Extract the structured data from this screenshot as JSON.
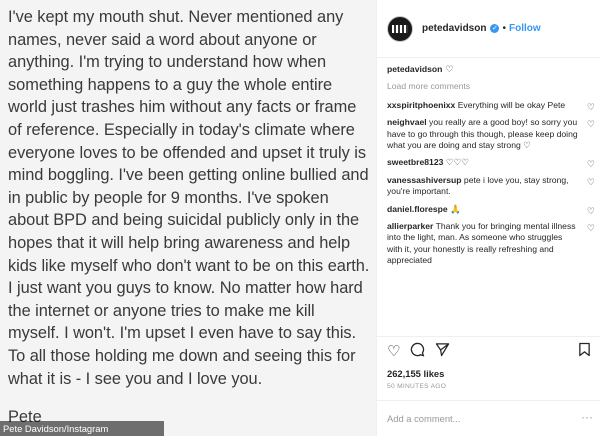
{
  "post": {
    "body": "I've kept my mouth shut. Never mentioned any names, never said a word about anyone or anything. I'm trying to understand how when something happens to a guy the whole entire world just trashes him without any facts or frame of reference. Especially in today's climate where everyone loves to be offended and upset it truly is mind boggling. I've been getting online bullied and in public by people for 9 months. I've spoken about BPD and being suicidal publicly only in the hopes that it will help bring awareness and help kids like myself who don't want to be on this earth. I just want you guys to know. No matter how hard the internet or anyone tries to make me kill myself. I won't. I'm upset I even have to say this. To all those holding me down and seeing this for what it is - I see you and I love you.",
    "signature": "Pete"
  },
  "header": {
    "username": "petedavidson",
    "verified_icon": "verified-badge-icon",
    "separator": "•",
    "follow_label": "Follow"
  },
  "caption": {
    "username": "petedavidson",
    "heart": "♡"
  },
  "load_more": "Load more comments",
  "comments": [
    {
      "username": "xxspiritphoenixx",
      "text": "Everything will be okay Pete"
    },
    {
      "username": "neighvael",
      "text": "you really are a good boy! so sorry you have to go through this though, please keep doing what you are doing and stay strong ♡"
    },
    {
      "username": "sweetbre8123",
      "text": "♡♡♡"
    },
    {
      "username": "vanessashiversup",
      "text": "pete i love you, stay strong, you're important."
    },
    {
      "username": "daniel.florespe",
      "text": "🙏"
    },
    {
      "username": "allierparker",
      "text": "Thank you for bringing mental illness into the light, man. As someone who struggles with it, your honestly is really refreshing and appreciated"
    }
  ],
  "actions": {
    "like_icon": "heart-icon",
    "comment_icon": "comment-icon",
    "share_icon": "share-icon",
    "save_icon": "bookmark-icon"
  },
  "likes": "262,155 likes",
  "timestamp": "50 MINUTES AGO",
  "add_comment_placeholder": "Add a comment...",
  "more_glyph": "···",
  "credit": "Pete Davidson/Instagram",
  "colors": {
    "link": "#3897f0",
    "muted": "#999999",
    "text": "#262626"
  }
}
